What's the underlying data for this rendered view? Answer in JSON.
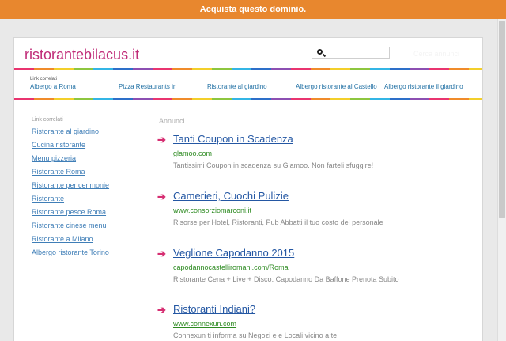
{
  "top_banner": {
    "label": "Acquista questo dominio."
  },
  "header": {
    "domain": "ristorantebilacus.it",
    "search": {
      "value": "",
      "placeholder": ""
    },
    "search_button": "Cerca annunci"
  },
  "related": {
    "title": "Link correlati",
    "links": [
      "Albergo a Roma",
      "Pizza Restaurants in",
      "Ristorante al giardino",
      "Albergo ristorante al Castello",
      "Albergo ristorante il giardino"
    ]
  },
  "sidebar": {
    "title": "Link correlati",
    "links": [
      "Ristorante al giardino",
      "Cucina ristorante",
      "Menu pizzeria",
      "Ristorante Roma",
      "Ristorante per cerimonie",
      "Ristorante",
      "Ristorante pesce Roma",
      "Ristorante cinese menu",
      "Ristorante a Milano",
      "Albergo ristorante Torino"
    ]
  },
  "ads": {
    "label": "Annunci",
    "arrow_icon": "right-arrow",
    "items": [
      {
        "title": "Tanti Coupon in Scadenza",
        "url": "glamoo.com",
        "description": "Tantissimi Coupon in scadenza su Glamoo. Non farteli sfuggire!"
      },
      {
        "title": "Camerieri, Cuochi Pulizie",
        "url": "www.consorziomarconi.it",
        "description": "Risorse per Hotel, Ristoranti, Pub Abbatti il tuo costo del personale"
      },
      {
        "title": "Veglione Capodanno 2015",
        "url": "capodannocastelliromani.com/Roma",
        "description": "Ristorante Cena + Live + Disco. Capodanno Da Baffone Prenota Subito"
      },
      {
        "title": "Ristoranti Indiani?",
        "url": "www.connexun.com",
        "description": "Connexun ti informa su Negozi e e Locali vicino a te"
      }
    ]
  },
  "colors": {
    "banner": "#e8872e",
    "domain": "#c02c78",
    "link": "#3f7eb7",
    "ad_title": "#2457a3",
    "ad_url": "#2e8b22",
    "arrow": "#d62e72"
  }
}
